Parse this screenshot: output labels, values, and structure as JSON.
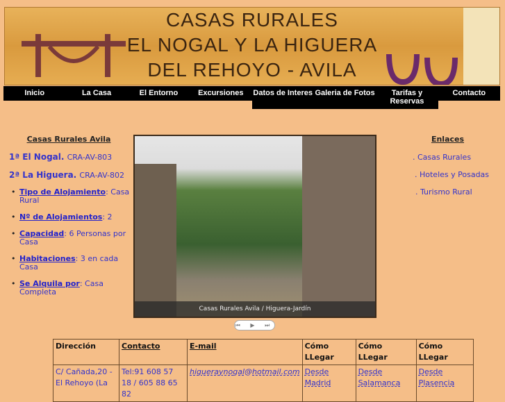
{
  "banner": {
    "line1": "CASAS RURALES",
    "line2": "EL NOGAL Y LA HIGUERA",
    "line3": "DEL REHOYO - AVILA"
  },
  "nav": [
    "Inicio",
    "La Casa",
    "El Entorno",
    "Excursiones",
    "Datos de Interes",
    "Galeria de Fotos",
    "Tarifas y Reservas",
    "Contacto"
  ],
  "left": {
    "title": "Casas Rurales Avila",
    "houses": [
      {
        "name": "1ª El Nogal.",
        "code": "CRA-AV-803"
      },
      {
        "name": "2ª La Higuera.",
        "code": "CRA-AV-802"
      }
    ],
    "items": [
      {
        "label": "Tipo de Alojamiento",
        "value": ": Casa Rural"
      },
      {
        "label": "Nº de Alojamientos",
        "value": ": 2"
      },
      {
        "label": "Capacidad",
        "value": ": 6 Personas por Casa"
      },
      {
        "label": "Habitaciones",
        "value": ": 3 en cada Casa"
      },
      {
        "label": "Se Alquila por",
        "value": ": Casa Completa"
      }
    ]
  },
  "slideshow": {
    "caption": "Casas Rurales Avila / Higuera-Jardín",
    "controls": "⏮ ▶ ⏭"
  },
  "right": {
    "title": "Enlaces",
    "links": [
      ". Casas Rurales",
      ". Hoteles y Posadas",
      ". Turismo Rural"
    ]
  },
  "table": {
    "headers": [
      "Dirección",
      "Contacto",
      "E-mail",
      "Cómo LLegar",
      "Cómo LLegar",
      "Cómo LLegar"
    ],
    "row": [
      "C/ Cañada,20 - El Rehoyo (La",
      "Tel:91 608 57 18 / 605 88 65 82",
      "higueraynogal@hotmail.com",
      "Desde Madrid",
      "Desde Salamanca",
      "Desde Plasencia"
    ]
  }
}
